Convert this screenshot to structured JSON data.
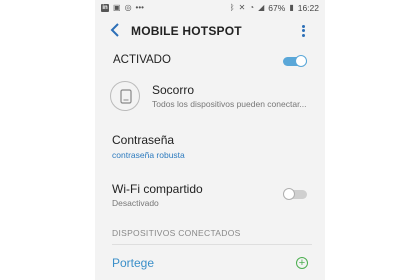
{
  "status_bar": {
    "left_icons": [
      "linkedin-icon",
      "image-icon",
      "whatsapp-icon",
      "more-dots-icon"
    ],
    "right_icons": [
      "bluetooth-icon",
      "mute-icon",
      "wifi-icon",
      "signal-icon"
    ],
    "battery": "67%",
    "time": "16:22"
  },
  "app_bar": {
    "title": "MOBILE HOTSPOT",
    "back_icon": "chevron-left-icon",
    "menu_icon": "more-vert-icon"
  },
  "hotspot": {
    "label": "ACTIVADO",
    "enabled": true,
    "accent": "#5aa7d8"
  },
  "network": {
    "name": "Socorro",
    "subtitle": "Todos los dispositivos pueden conectar..."
  },
  "password": {
    "label": "Contraseña",
    "value": "contraseña robusta"
  },
  "wifi_sharing": {
    "label": "Wi-Fi compartido",
    "status": "Desactivado",
    "enabled": false
  },
  "connected_devices": {
    "header": "DISPOSITIVOS CONECTADOS",
    "items": [
      {
        "name": "Portege"
      }
    ]
  }
}
